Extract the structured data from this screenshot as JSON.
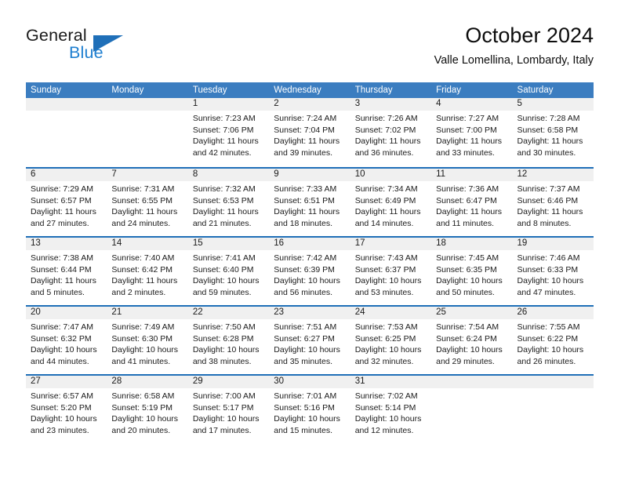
{
  "brand": {
    "word_one": "General",
    "word_two": "Blue",
    "flag_icon": "triangle-flag-icon",
    "accent_color": "#1f7fd0"
  },
  "header": {
    "title": "October 2024",
    "subtitle": "Valle Lomellina, Lombardy, Italy"
  },
  "theme": {
    "header_blue": "#3b7dc0",
    "rule_blue": "#1f6fb8",
    "day_band_gray": "#f0f0f0"
  },
  "weekdays": [
    "Sunday",
    "Monday",
    "Tuesday",
    "Wednesday",
    "Thursday",
    "Friday",
    "Saturday"
  ],
  "weeks": [
    [
      {
        "day": "",
        "lines": []
      },
      {
        "day": "",
        "lines": []
      },
      {
        "day": "1",
        "lines": [
          "Sunrise: 7:23 AM",
          "Sunset: 7:06 PM",
          "Daylight: 11 hours",
          "and 42 minutes."
        ]
      },
      {
        "day": "2",
        "lines": [
          "Sunrise: 7:24 AM",
          "Sunset: 7:04 PM",
          "Daylight: 11 hours",
          "and 39 minutes."
        ]
      },
      {
        "day": "3",
        "lines": [
          "Sunrise: 7:26 AM",
          "Sunset: 7:02 PM",
          "Daylight: 11 hours",
          "and 36 minutes."
        ]
      },
      {
        "day": "4",
        "lines": [
          "Sunrise: 7:27 AM",
          "Sunset: 7:00 PM",
          "Daylight: 11 hours",
          "and 33 minutes."
        ]
      },
      {
        "day": "5",
        "lines": [
          "Sunrise: 7:28 AM",
          "Sunset: 6:58 PM",
          "Daylight: 11 hours",
          "and 30 minutes."
        ]
      }
    ],
    [
      {
        "day": "6",
        "lines": [
          "Sunrise: 7:29 AM",
          "Sunset: 6:57 PM",
          "Daylight: 11 hours",
          "and 27 minutes."
        ]
      },
      {
        "day": "7",
        "lines": [
          "Sunrise: 7:31 AM",
          "Sunset: 6:55 PM",
          "Daylight: 11 hours",
          "and 24 minutes."
        ]
      },
      {
        "day": "8",
        "lines": [
          "Sunrise: 7:32 AM",
          "Sunset: 6:53 PM",
          "Daylight: 11 hours",
          "and 21 minutes."
        ]
      },
      {
        "day": "9",
        "lines": [
          "Sunrise: 7:33 AM",
          "Sunset: 6:51 PM",
          "Daylight: 11 hours",
          "and 18 minutes."
        ]
      },
      {
        "day": "10",
        "lines": [
          "Sunrise: 7:34 AM",
          "Sunset: 6:49 PM",
          "Daylight: 11 hours",
          "and 14 minutes."
        ]
      },
      {
        "day": "11",
        "lines": [
          "Sunrise: 7:36 AM",
          "Sunset: 6:47 PM",
          "Daylight: 11 hours",
          "and 11 minutes."
        ]
      },
      {
        "day": "12",
        "lines": [
          "Sunrise: 7:37 AM",
          "Sunset: 6:46 PM",
          "Daylight: 11 hours",
          "and 8 minutes."
        ]
      }
    ],
    [
      {
        "day": "13",
        "lines": [
          "Sunrise: 7:38 AM",
          "Sunset: 6:44 PM",
          "Daylight: 11 hours",
          "and 5 minutes."
        ]
      },
      {
        "day": "14",
        "lines": [
          "Sunrise: 7:40 AM",
          "Sunset: 6:42 PM",
          "Daylight: 11 hours",
          "and 2 minutes."
        ]
      },
      {
        "day": "15",
        "lines": [
          "Sunrise: 7:41 AM",
          "Sunset: 6:40 PM",
          "Daylight: 10 hours",
          "and 59 minutes."
        ]
      },
      {
        "day": "16",
        "lines": [
          "Sunrise: 7:42 AM",
          "Sunset: 6:39 PM",
          "Daylight: 10 hours",
          "and 56 minutes."
        ]
      },
      {
        "day": "17",
        "lines": [
          "Sunrise: 7:43 AM",
          "Sunset: 6:37 PM",
          "Daylight: 10 hours",
          "and 53 minutes."
        ]
      },
      {
        "day": "18",
        "lines": [
          "Sunrise: 7:45 AM",
          "Sunset: 6:35 PM",
          "Daylight: 10 hours",
          "and 50 minutes."
        ]
      },
      {
        "day": "19",
        "lines": [
          "Sunrise: 7:46 AM",
          "Sunset: 6:33 PM",
          "Daylight: 10 hours",
          "and 47 minutes."
        ]
      }
    ],
    [
      {
        "day": "20",
        "lines": [
          "Sunrise: 7:47 AM",
          "Sunset: 6:32 PM",
          "Daylight: 10 hours",
          "and 44 minutes."
        ]
      },
      {
        "day": "21",
        "lines": [
          "Sunrise: 7:49 AM",
          "Sunset: 6:30 PM",
          "Daylight: 10 hours",
          "and 41 minutes."
        ]
      },
      {
        "day": "22",
        "lines": [
          "Sunrise: 7:50 AM",
          "Sunset: 6:28 PM",
          "Daylight: 10 hours",
          "and 38 minutes."
        ]
      },
      {
        "day": "23",
        "lines": [
          "Sunrise: 7:51 AM",
          "Sunset: 6:27 PM",
          "Daylight: 10 hours",
          "and 35 minutes."
        ]
      },
      {
        "day": "24",
        "lines": [
          "Sunrise: 7:53 AM",
          "Sunset: 6:25 PM",
          "Daylight: 10 hours",
          "and 32 minutes."
        ]
      },
      {
        "day": "25",
        "lines": [
          "Sunrise: 7:54 AM",
          "Sunset: 6:24 PM",
          "Daylight: 10 hours",
          "and 29 minutes."
        ]
      },
      {
        "day": "26",
        "lines": [
          "Sunrise: 7:55 AM",
          "Sunset: 6:22 PM",
          "Daylight: 10 hours",
          "and 26 minutes."
        ]
      }
    ],
    [
      {
        "day": "27",
        "lines": [
          "Sunrise: 6:57 AM",
          "Sunset: 5:20 PM",
          "Daylight: 10 hours",
          "and 23 minutes."
        ]
      },
      {
        "day": "28",
        "lines": [
          "Sunrise: 6:58 AM",
          "Sunset: 5:19 PM",
          "Daylight: 10 hours",
          "and 20 minutes."
        ]
      },
      {
        "day": "29",
        "lines": [
          "Sunrise: 7:00 AM",
          "Sunset: 5:17 PM",
          "Daylight: 10 hours",
          "and 17 minutes."
        ]
      },
      {
        "day": "30",
        "lines": [
          "Sunrise: 7:01 AM",
          "Sunset: 5:16 PM",
          "Daylight: 10 hours",
          "and 15 minutes."
        ]
      },
      {
        "day": "31",
        "lines": [
          "Sunrise: 7:02 AM",
          "Sunset: 5:14 PM",
          "Daylight: 10 hours",
          "and 12 minutes."
        ]
      },
      {
        "day": "",
        "lines": []
      },
      {
        "day": "",
        "lines": []
      }
    ]
  ]
}
